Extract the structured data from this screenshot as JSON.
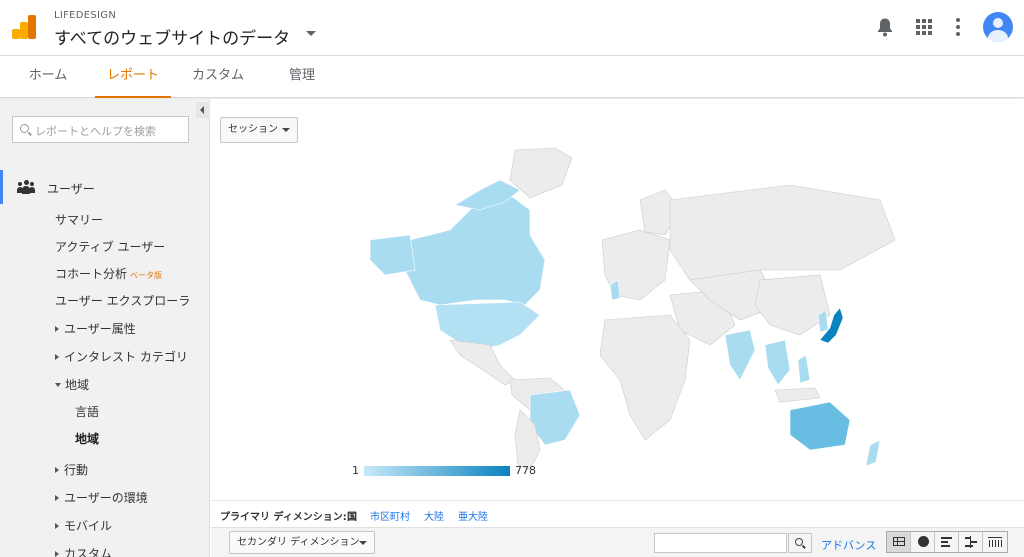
{
  "header": {
    "account": "LIFEDESIGN",
    "property": "すべてのウェブサイトのデータ"
  },
  "tabs": [
    {
      "label": "ホーム",
      "active": false
    },
    {
      "label": "レポート",
      "active": true
    },
    {
      "label": "カスタム",
      "active": false
    },
    {
      "label": "管理",
      "active": false
    }
  ],
  "sidebar": {
    "search_placeholder": "レポートとヘルプを検索",
    "section": "ユーザー",
    "items": {
      "summary": "サマリー",
      "active_users": "アクティブ ユーザー",
      "cohort": "コホート分析",
      "cohort_badge": "ベータ版",
      "explorer": "ユーザー エクスプローラ",
      "demographics": "ユーザー属性",
      "interests": "インタレスト カテゴリ",
      "geo": "地域",
      "language": "言語",
      "location": "地域",
      "behavior": "行動",
      "technology": "ユーザーの環境",
      "mobile": "モバイル",
      "custom": "カスタム"
    }
  },
  "main": {
    "metric_select": "セッション",
    "legend": {
      "min": "1",
      "max": "778"
    },
    "primary_dimension": {
      "label": "プライマリ ディメンション:",
      "current": "国",
      "options": [
        "市区町村",
        "大陸",
        "亜大陸"
      ]
    },
    "secondary_dimension": "セカンダリ ディメンション",
    "advanced": "アドバンス"
  },
  "colors": {
    "accent": "#e37400",
    "link": "#1a73e8",
    "map_min": "#c6e9f8",
    "map_max": "#0b82c0",
    "land": "#ececec"
  }
}
